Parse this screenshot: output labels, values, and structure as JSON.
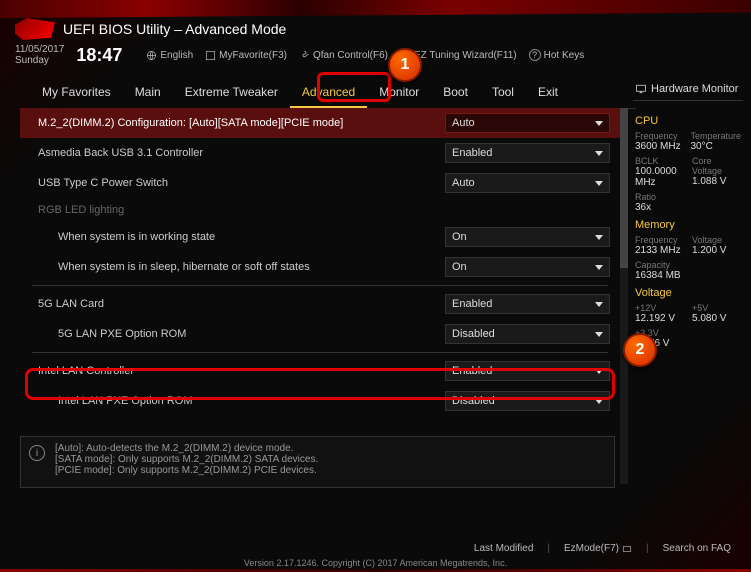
{
  "title": "UEFI BIOS Utility – Advanced Mode",
  "date": "11/05/2017",
  "day": "Sunday",
  "time": "18:47",
  "toolbar": {
    "language": "English",
    "favorite": "MyFavorite(F3)",
    "qfan": "Qfan Control(F6)",
    "ez": "EZ Tuning Wizard(F11)",
    "hotkeys": "Hot Keys"
  },
  "menu": [
    "My Favorites",
    "Main",
    "Extreme Tweaker",
    "Advanced",
    "Monitor",
    "Boot",
    "Tool",
    "Exit"
  ],
  "menu_active": 3,
  "settings": [
    {
      "type": "row",
      "label": "M.2_2(DIMM.2) Configuration: [Auto][SATA mode][PCIE mode]",
      "value": "Auto",
      "hl": true
    },
    {
      "type": "row",
      "label": "Asmedia Back USB 3.1 Controller",
      "value": "Enabled"
    },
    {
      "type": "row",
      "label": "USB Type C Power Switch",
      "value": "Auto"
    },
    {
      "type": "section",
      "label": "RGB LED lighting"
    },
    {
      "type": "row",
      "label": "When system is in working state",
      "value": "On",
      "indent": true
    },
    {
      "type": "row",
      "label": "When system is in sleep, hibernate or soft off states",
      "value": "On",
      "indent": true
    },
    {
      "type": "sep"
    },
    {
      "type": "row",
      "label": "5G LAN Card",
      "value": "Enabled"
    },
    {
      "type": "row",
      "label": "5G LAN PXE Option ROM",
      "value": "Disabled",
      "indent": true
    },
    {
      "type": "sep"
    },
    {
      "type": "row",
      "label": "Intel LAN Controller",
      "value": "Enabled"
    },
    {
      "type": "row",
      "label": "Intel LAN PXE Option ROM",
      "value": "Disabled",
      "indent": true
    }
  ],
  "help": [
    "[Auto]: Auto-detects the M.2_2(DIMM.2) device mode.",
    "[SATA mode]: Only supports M.2_2(DIMM.2) SATA devices.",
    "[PCIE mode]: Only supports M.2_2(DIMM.2) PCIE devices."
  ],
  "hw": {
    "title": "Hardware Monitor",
    "cpu": {
      "heading": "CPU",
      "freq_l": "Frequency",
      "freq": "3600 MHz",
      "temp_l": "Temperature",
      "temp": "30°C",
      "bclk_l": "BCLK",
      "bclk": "100.0000 MHz",
      "cv_l": "Core Voltage",
      "cv": "1.088 V",
      "ratio_l": "Ratio",
      "ratio": "36x"
    },
    "mem": {
      "heading": "Memory",
      "freq_l": "Frequency",
      "freq": "2133 MHz",
      "volt_l": "Voltage",
      "volt": "1.200 V",
      "cap_l": "Capacity",
      "cap": "16384 MB"
    },
    "volt": {
      "heading": "Voltage",
      "v12_l": "+12V",
      "v12": "12.192 V",
      "v5_l": "+5V",
      "v5": "5.080 V",
      "v33_l": "+3.3V",
      "v33": "3.376 V"
    }
  },
  "footer": {
    "last": "Last Modified",
    "ez": "EzMode(F7)",
    "faq": "Search on FAQ"
  },
  "copyright": "Version 2.17.1246. Copyright (C) 2017 American Megatrends, Inc."
}
